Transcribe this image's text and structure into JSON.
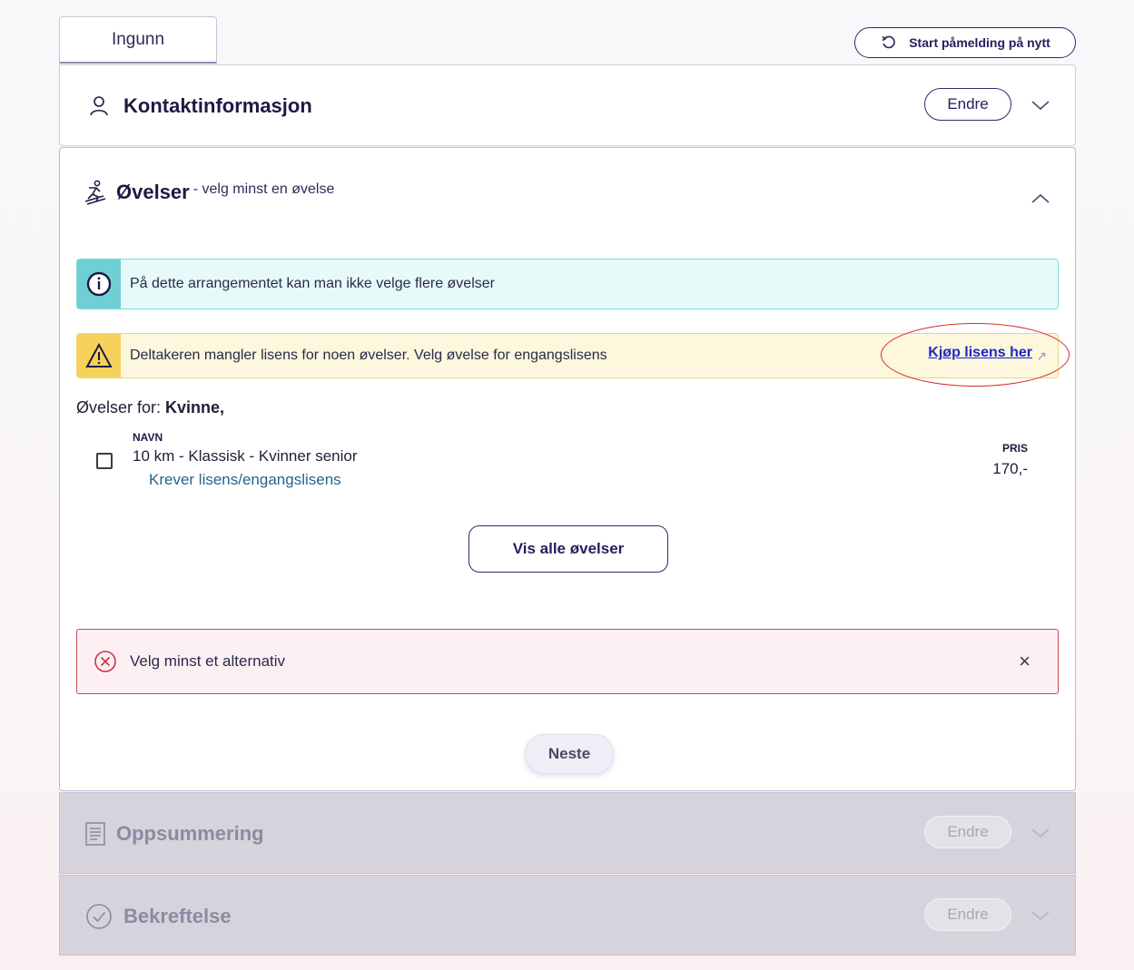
{
  "tab": {
    "label": "Ingunn"
  },
  "restart": {
    "label": "Start påmelding på nytt"
  },
  "sections": {
    "contact": {
      "title": "Kontaktinformasjon",
      "edit_label": "Endre"
    },
    "ovelser": {
      "title": "Øvelser",
      "subtitle": "- velg minst en øvelse",
      "info": "På dette arrangementet kan man ikke velge flere øvelser",
      "warning": "Deltakeren mangler lisens for noen øvelser. Velg øvelse for engangslisens",
      "buy_license_link": "Kjøp lisens her",
      "for_prefix": "Øvelser for: ",
      "for_value": "Kvinne,",
      "col_name": "NAVN",
      "col_price": "PRIS",
      "event": {
        "name": "10 km - Klassisk - Kvinner senior",
        "requirement": "Krever lisens/engangslisens",
        "price": "170,-",
        "checked": false
      },
      "show_all_label": "Vis alle øvelser",
      "error": "Velg minst et alternativ",
      "error_close": "×",
      "next_label": "Neste"
    },
    "summary": {
      "title": "Oppsummering",
      "edit_label": "Endre"
    },
    "confirm": {
      "title": "Bekreftelse",
      "edit_label": "Endre"
    }
  },
  "colors": {
    "primary": "#2d2a6e",
    "info_bar": "#6fd0d3",
    "warn_bar": "#f6d25a",
    "error_border": "#c9495a",
    "link": "#2026c7",
    "annotation": "#d8282b"
  }
}
